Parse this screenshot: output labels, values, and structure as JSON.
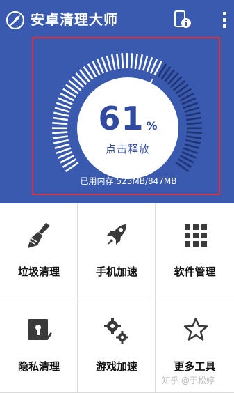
{
  "app": {
    "title": "安卓清理大师"
  },
  "header_icons": {
    "app": "broom-rocket-icon",
    "info": "phone-info-icon",
    "more": "more-vertical-icon"
  },
  "memory": {
    "percent": "61",
    "percent_unit": "%",
    "action_label": "点击释放",
    "usage_text": "已用内存:525MB/847MB",
    "used_fraction": 0.61
  },
  "tools": [
    {
      "label": "垃圾清理",
      "icon": "broom-icon"
    },
    {
      "label": "手机加速",
      "icon": "rocket-icon"
    },
    {
      "label": "软件管理",
      "icon": "apps-grid-icon"
    },
    {
      "label": "隐私清理",
      "icon": "privacy-lock-icon"
    },
    {
      "label": "游戏加速",
      "icon": "gears-icon"
    },
    {
      "label": "更多工具",
      "icon": "star-icon"
    }
  ],
  "watermark": "知乎 @于松婷",
  "colors": {
    "header_bg": "#3a5ab0",
    "accent": "#2f4aa0",
    "highlight_border": "#e0303c"
  }
}
